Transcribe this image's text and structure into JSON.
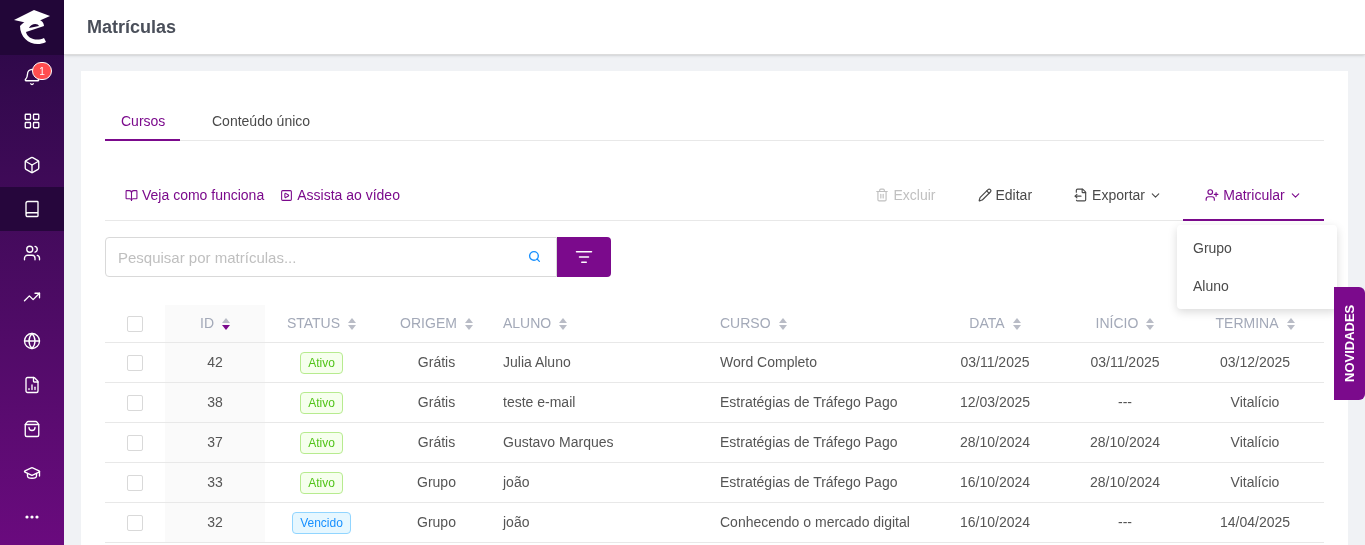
{
  "sidebar": {
    "notification_count": "1",
    "items": [
      {
        "selected": false
      },
      {
        "selected": false
      },
      {
        "selected": false
      },
      {
        "selected": true
      },
      {
        "selected": false
      },
      {
        "selected": false
      },
      {
        "selected": false
      },
      {
        "selected": false
      },
      {
        "selected": false
      },
      {
        "selected": false
      }
    ]
  },
  "header": {
    "title": "Matrículas"
  },
  "tabs": [
    {
      "label": "Cursos",
      "selected": true
    },
    {
      "label": "Conteúdo único",
      "selected": false
    }
  ],
  "help_links": [
    "Veja como funciona",
    "Assista ao vídeo"
  ],
  "actions": [
    {
      "label": "Excluir",
      "disabled": true,
      "selected": false,
      "dropdown": false
    },
    {
      "label": "Editar",
      "disabled": false,
      "selected": false,
      "dropdown": false
    },
    {
      "label": "Exportar",
      "disabled": false,
      "selected": false,
      "dropdown": true
    },
    {
      "label": "Matricular",
      "disabled": false,
      "selected": true,
      "dropdown": true
    }
  ],
  "dropdown_menu": {
    "items": [
      "Grupo",
      "Aluno"
    ]
  },
  "search": {
    "placeholder": "Pesquisar por matrículas..."
  },
  "table": {
    "select_all_checked": false,
    "columns": [
      {
        "label": "ID",
        "sorted": true
      },
      {
        "label": "STATUS",
        "sorted": false
      },
      {
        "label": "ORIGEM",
        "sorted": false
      },
      {
        "label": "ALUNO",
        "sorted": false
      },
      {
        "label": "CURSO",
        "sorted": false
      },
      {
        "label": "DATA",
        "sorted": false
      },
      {
        "label": "INÍCIO",
        "sorted": false
      },
      {
        "label": "TERMINA",
        "sorted": false
      }
    ],
    "rows": [
      {
        "checked": false,
        "id": "42",
        "status": {
          "label": "Ativo",
          "kind": "active"
        },
        "origin": "Grátis",
        "student": "Julia Aluno",
        "course": "Word Completo",
        "date": "03/11/2025",
        "start": "03/11/2025",
        "end": "03/12/2025"
      },
      {
        "checked": false,
        "id": "38",
        "status": {
          "label": "Ativo",
          "kind": "active"
        },
        "origin": "Grátis",
        "student": "teste e-mail",
        "course": "Estratégias de Tráfego Pago",
        "date": "12/03/2025",
        "start": "---",
        "end": "Vitalício"
      },
      {
        "checked": false,
        "id": "37",
        "status": {
          "label": "Ativo",
          "kind": "active"
        },
        "origin": "Grátis",
        "student": "Gustavo Marques",
        "course": "Estratégias de Tráfego Pago",
        "date": "28/10/2024",
        "start": "28/10/2024",
        "end": "Vitalício"
      },
      {
        "checked": false,
        "id": "33",
        "status": {
          "label": "Ativo",
          "kind": "active"
        },
        "origin": "Grupo",
        "student": "joão",
        "course": "Estratégias de Tráfego Pago",
        "date": "16/10/2024",
        "start": "28/10/2024",
        "end": "Vitalício"
      },
      {
        "checked": false,
        "id": "32",
        "status": {
          "label": "Vencido",
          "kind": "expired"
        },
        "origin": "Grupo",
        "student": "joão",
        "course": "Conhecendo o mercado digital",
        "date": "16/10/2024",
        "start": "---",
        "end": "14/04/2025"
      }
    ]
  },
  "news_tab": {
    "label": "NOVIDADES"
  }
}
